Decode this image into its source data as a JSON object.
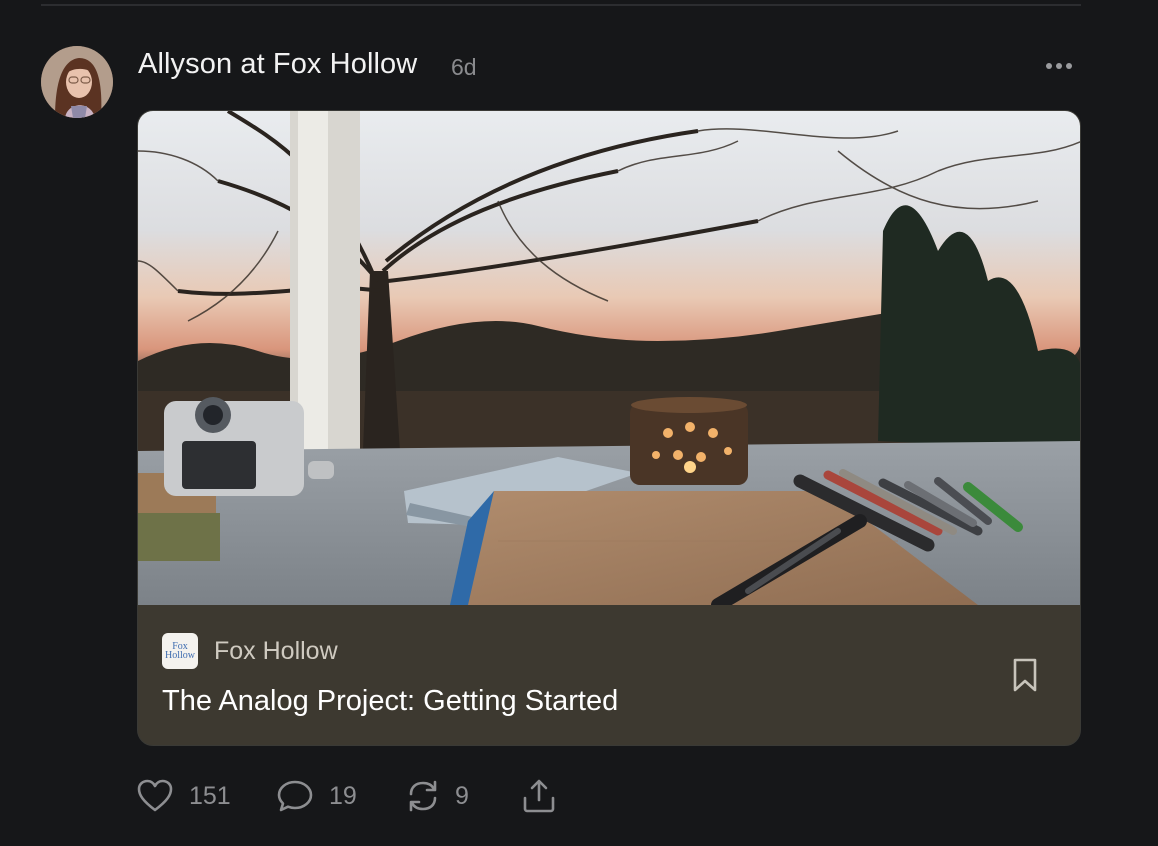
{
  "post": {
    "author": "Allyson at Fox Hollow",
    "time": "6d"
  },
  "card": {
    "publication": "Fox Hollow",
    "logo_text": [
      "Fox",
      "Hollow"
    ],
    "title": "The Analog Project: Getting Started"
  },
  "actions": {
    "likes": "151",
    "comments": "19",
    "restacks": "9"
  },
  "icons": [
    "heart-icon",
    "comment-icon",
    "restack-icon",
    "share-icon",
    "bookmark-icon",
    "more-icon"
  ],
  "colors": {
    "background": "#161719",
    "card_footer": "#3d3930",
    "muted_text": "#8d8e91"
  }
}
